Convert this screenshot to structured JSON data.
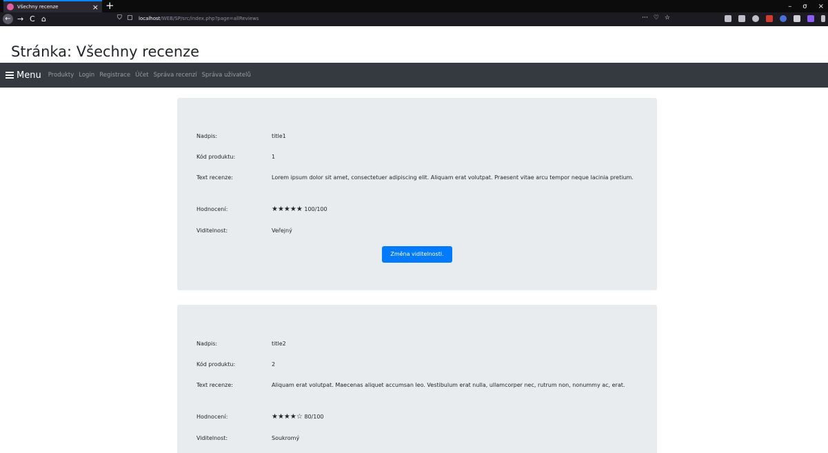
{
  "browser": {
    "tab_title": "Všechny recenze",
    "tab_close": "×",
    "new_tab": "+",
    "win_min": "–",
    "win_max": "σ",
    "win_close": "×",
    "url_host": "localhost",
    "url_rest": "/WEB/SP/src/index.php?page=allReviews",
    "url_more": "···",
    "icons": {
      "back": "←",
      "forward": "→",
      "reload": "C",
      "home": "⌂",
      "shield": "⛉",
      "page": "▢",
      "pocket": "♡",
      "star": "☆"
    }
  },
  "page": {
    "title": "Stránka: Všechny recenze"
  },
  "nav": {
    "menu_label": "Menu",
    "links": [
      "Produkty",
      "Login",
      "Registrace",
      "Účet",
      "Správa recenzí",
      "Správa uživatelů"
    ]
  },
  "labels": {
    "title": "Nadpis:",
    "product_code": "Kód produktu:",
    "text": "Text recenze:",
    "rating": "Hodnocení:",
    "visibility": "Viditelnost:"
  },
  "reviews": [
    {
      "title": "title1",
      "product_code": "1",
      "text": "Lorem ipsum dolor sit amet, consectetuer adipiscing elit. Aliquam erat volutpat. Praesent vitae arcu tempor neque lacinia pretium.",
      "stars": "★★★★★",
      "rating": "100/100",
      "visibility": "Veřejný",
      "button": "Změna viditelnosti."
    },
    {
      "title": "title2",
      "product_code": "2",
      "text": "Aliquam erat volutpat. Maecenas aliquet accumsan leo. Vestibulum erat nulla, ullamcorper nec, rutrum non, nonummy ac, erat.",
      "stars": "★★★★☆",
      "rating": "80/100",
      "visibility": "Soukromý"
    }
  ],
  "colors": {
    "navbar": "#343a40",
    "card": "#e9ecef",
    "primary": "#007bff"
  }
}
